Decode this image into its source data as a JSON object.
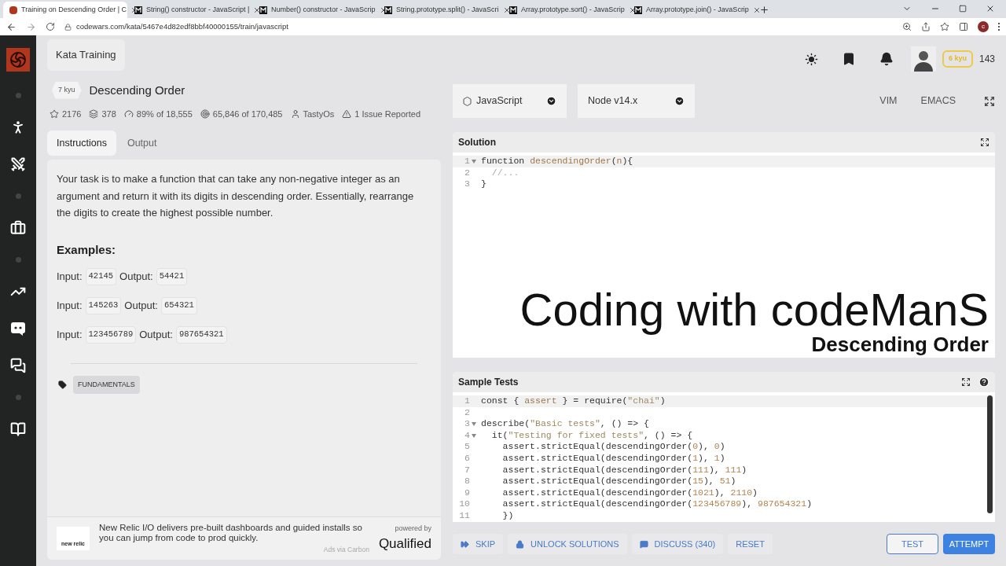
{
  "browser": {
    "tabs": [
      {
        "title": "Training on Descending Order | C",
        "kind": "codewars",
        "selected": true
      },
      {
        "title": "String() constructor - JavaScript |",
        "kind": "mdn",
        "selected": false
      },
      {
        "title": "Number() constructor - JavaScrip",
        "kind": "mdn",
        "selected": false
      },
      {
        "title": "String.prototype.split() - JavaScri",
        "kind": "mdn",
        "selected": false
      },
      {
        "title": "Array.prototype.sort() - JavaScrip",
        "kind": "mdn",
        "selected": false
      },
      {
        "title": "Array.prototype.join() - JavaScrip",
        "kind": "mdn",
        "selected": false
      }
    ],
    "url": "codewars.com/kata/5467e4d82edf8bbf40000155/train/javascript",
    "profile": "c"
  },
  "header": {
    "breadcrumb": "Kata Training",
    "rank": "6 kyu",
    "honor": "143"
  },
  "kata": {
    "rank": "7 kyu",
    "title": "Descending Order",
    "stats": [
      {
        "kind": "stars",
        "text": "2176"
      },
      {
        "kind": "collections",
        "text": "378"
      },
      {
        "kind": "satisfaction",
        "text": "89% of 18,555"
      },
      {
        "kind": "completed",
        "text": "65,846 of 170,485"
      },
      {
        "kind": "author",
        "text": "TastyOs"
      },
      {
        "kind": "issues",
        "text": "1 Issue Reported"
      }
    ]
  },
  "tabs": [
    {
      "label": "Instructions",
      "selected": true
    },
    {
      "label": "Output",
      "selected": false
    }
  ],
  "instructions": {
    "paragraph": "Your task is to make a function that can take any non-negative integer as an argument and return it with its digits in descending order. Essentially, rearrange the digits to create the highest possible number.",
    "heading": "Examples:",
    "examples": [
      {
        "input_label": "Input:",
        "input": "42145",
        "output_label": "Output:",
        "output": "54421"
      },
      {
        "input_label": "Input:",
        "input": "145263",
        "output_label": "Output:",
        "output": "654321"
      },
      {
        "input_label": "Input:",
        "input": "123456789",
        "output_label": "Output:",
        "output": "987654321"
      }
    ],
    "tags": [
      "FUNDAMENTALS"
    ]
  },
  "ad": {
    "logo": "new relic",
    "text": "New Relic I/O delivers pre-built dashboards and guided installs so you can jump from code to prod quickly.",
    "via": "Ads via Carbon",
    "powered": "powered by",
    "brand": "Qualified"
  },
  "editor": {
    "language": "JavaScript",
    "runtime": "Node v14.x",
    "modes": [
      "VIM",
      "EMACS"
    ]
  },
  "solution": {
    "title": "Solution",
    "lines": [
      {
        "number": "1",
        "foldable": true,
        "current": true,
        "tokens": [
          {
            "t": "function ",
            "kind": "plain"
          },
          {
            "t": "descendingOrder",
            "kind": "fn"
          },
          {
            "t": "(",
            "kind": "plain"
          },
          {
            "t": "n",
            "kind": "fn"
          },
          {
            "t": "){",
            "kind": "plain"
          }
        ]
      },
      {
        "number": "2",
        "foldable": false,
        "current": false,
        "tokens": [
          {
            "t": "  //...",
            "kind": "cmt"
          }
        ]
      },
      {
        "number": "3",
        "foldable": false,
        "current": false,
        "tokens": [
          {
            "t": "}",
            "kind": "plain"
          }
        ]
      }
    ]
  },
  "video_overlay": {
    "title": "Coding with codeManS",
    "subtitle": "Descending Order"
  },
  "sample_tests": {
    "title": "Sample Tests",
    "lines": [
      {
        "number": "1",
        "foldable": false,
        "current": true,
        "tokens": [
          {
            "t": "const { ",
            "kind": "plain"
          },
          {
            "t": "assert",
            "kind": "fn"
          },
          {
            "t": " } = require(",
            "kind": "plain"
          },
          {
            "t": "\"chai\"",
            "kind": "str"
          },
          {
            "t": ")",
            "kind": "plain"
          }
        ]
      },
      {
        "number": "2",
        "foldable": false,
        "current": false
      },
      {
        "number": "3",
        "foldable": true,
        "current": false,
        "tokens": [
          {
            "t": "describe(",
            "kind": "plain"
          },
          {
            "t": "\"Basic tests\"",
            "kind": "str"
          },
          {
            "t": ", () => {",
            "kind": "plain"
          }
        ]
      },
      {
        "number": "4",
        "foldable": true,
        "current": false,
        "tokens": [
          {
            "t": "  it(",
            "kind": "plain"
          },
          {
            "t": "\"Testing for fixed tests\"",
            "kind": "str"
          },
          {
            "t": ", () => {",
            "kind": "plain"
          }
        ]
      },
      {
        "number": "5",
        "foldable": false,
        "current": false,
        "tokens": [
          {
            "t": "    assert.strictEqual(descendingOrder(",
            "kind": "plain"
          },
          {
            "t": "0",
            "kind": "num"
          },
          {
            "t": "), ",
            "kind": "plain"
          },
          {
            "t": "0",
            "kind": "num"
          },
          {
            "t": ")",
            "kind": "plain"
          }
        ]
      },
      {
        "number": "6",
        "foldable": false,
        "current": false,
        "tokens": [
          {
            "t": "    assert.strictEqual(descendingOrder(",
            "kind": "plain"
          },
          {
            "t": "1",
            "kind": "num"
          },
          {
            "t": "), ",
            "kind": "plain"
          },
          {
            "t": "1",
            "kind": "num"
          },
          {
            "t": ")",
            "kind": "plain"
          }
        ]
      },
      {
        "number": "7",
        "foldable": false,
        "current": false,
        "tokens": [
          {
            "t": "    assert.strictEqual(descendingOrder(",
            "kind": "plain"
          },
          {
            "t": "111",
            "kind": "num"
          },
          {
            "t": "), ",
            "kind": "plain"
          },
          {
            "t": "111",
            "kind": "num"
          },
          {
            "t": ")",
            "kind": "plain"
          }
        ]
      },
      {
        "number": "8",
        "foldable": false,
        "current": false,
        "tokens": [
          {
            "t": "    assert.strictEqual(descendingOrder(",
            "kind": "plain"
          },
          {
            "t": "15",
            "kind": "num"
          },
          {
            "t": "), ",
            "kind": "plain"
          },
          {
            "t": "51",
            "kind": "num"
          },
          {
            "t": ")",
            "kind": "plain"
          }
        ]
      },
      {
        "number": "9",
        "foldable": false,
        "current": false,
        "tokens": [
          {
            "t": "    assert.strictEqual(descendingOrder(",
            "kind": "plain"
          },
          {
            "t": "1021",
            "kind": "num"
          },
          {
            "t": "), ",
            "kind": "plain"
          },
          {
            "t": "2110",
            "kind": "num"
          },
          {
            "t": ")",
            "kind": "plain"
          }
        ]
      },
      {
        "number": "10",
        "foldable": false,
        "current": false,
        "tokens": [
          {
            "t": "    assert.strictEqual(descendingOrder(",
            "kind": "plain"
          },
          {
            "t": "123456789",
            "kind": "num"
          },
          {
            "t": "), ",
            "kind": "plain"
          },
          {
            "t": "987654321",
            "kind": "num"
          },
          {
            "t": ")",
            "kind": "plain"
          }
        ]
      },
      {
        "number": "11",
        "foldable": false,
        "current": false,
        "tokens": [
          {
            "t": "    })",
            "kind": "plain"
          }
        ]
      }
    ]
  },
  "actions": [
    {
      "label": "SKIP",
      "kind": "skip"
    },
    {
      "label": "UNLOCK SOLUTIONS",
      "kind": "unlock"
    },
    {
      "label": "DISCUSS (340)",
      "kind": "discuss"
    },
    {
      "label": "RESET",
      "kind": "plain"
    }
  ],
  "submit": [
    {
      "label": "TEST",
      "kind": "outline"
    },
    {
      "label": "ATTEMPT",
      "kind": "primary"
    }
  ]
}
